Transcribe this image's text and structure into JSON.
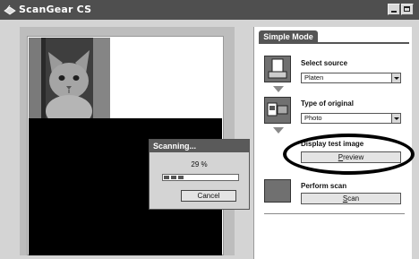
{
  "window": {
    "title": "ScanGear CS"
  },
  "panel": {
    "tab_label": "Simple Mode",
    "select_source": {
      "label": "Select source",
      "value": "Platen"
    },
    "type_of_original": {
      "label": "Type of original",
      "value": "Photo"
    },
    "display_test_image": {
      "label": "Display test image",
      "button_label": "Preview",
      "button_accel": "P",
      "button_rest": "review"
    },
    "perform_scan": {
      "label": "Perform scan",
      "button_label": "Scan",
      "button_accel": "S",
      "button_rest": "can"
    }
  },
  "dialog": {
    "title": "Scanning...",
    "percent_text": "29 %",
    "progress_fraction": 0.29,
    "cancel_label": "Cancel"
  },
  "colors": {
    "titlebar": "#4f4f4f",
    "tab": "#555555",
    "scan_area": "#000000"
  }
}
